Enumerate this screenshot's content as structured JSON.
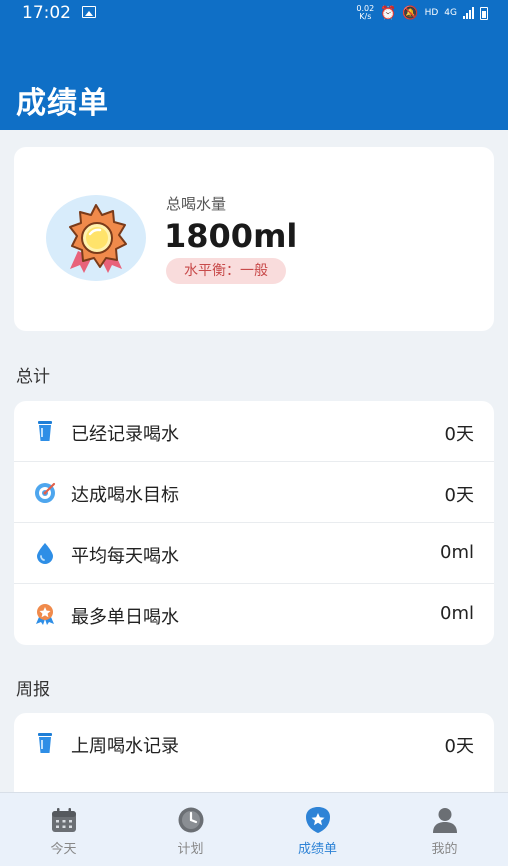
{
  "status_bar": {
    "time": "17:02",
    "net_speed_value": "0.02",
    "net_speed_unit": "K/s",
    "hd": "HD",
    "network": "4G"
  },
  "header": {
    "title": "成绩单"
  },
  "summary": {
    "label": "总喝水量",
    "value": "1800ml",
    "level": "水平衡：一般"
  },
  "totals": {
    "title": "总计",
    "items": [
      {
        "icon": "cup-icon",
        "label": "已经记录喝水",
        "value": "0天"
      },
      {
        "icon": "target-icon",
        "label": "达成喝水目标",
        "value": "0天"
      },
      {
        "icon": "water-drop-icon",
        "label": "平均每天喝水",
        "value": "0ml"
      },
      {
        "icon": "star-badge-icon",
        "label": "最多单日喝水",
        "value": "0ml"
      }
    ]
  },
  "weekly": {
    "title": "周报",
    "items": [
      {
        "icon": "cup-icon",
        "label": "上周喝水记录",
        "value": "0天"
      }
    ]
  },
  "tabbar": {
    "tabs": [
      {
        "label": "今天",
        "icon": "calendar-icon",
        "active": false
      },
      {
        "label": "计划",
        "icon": "clock-icon",
        "active": false
      },
      {
        "label": "成绩单",
        "icon": "report-badge-icon",
        "active": true
      },
      {
        "label": "我的",
        "icon": "person-icon",
        "active": false
      }
    ]
  },
  "colors": {
    "primary": "#0f6fc6",
    "tab_active": "#2e83d6",
    "badge_bg": "#f9dcdc",
    "badge_text": "#c84a4a"
  }
}
